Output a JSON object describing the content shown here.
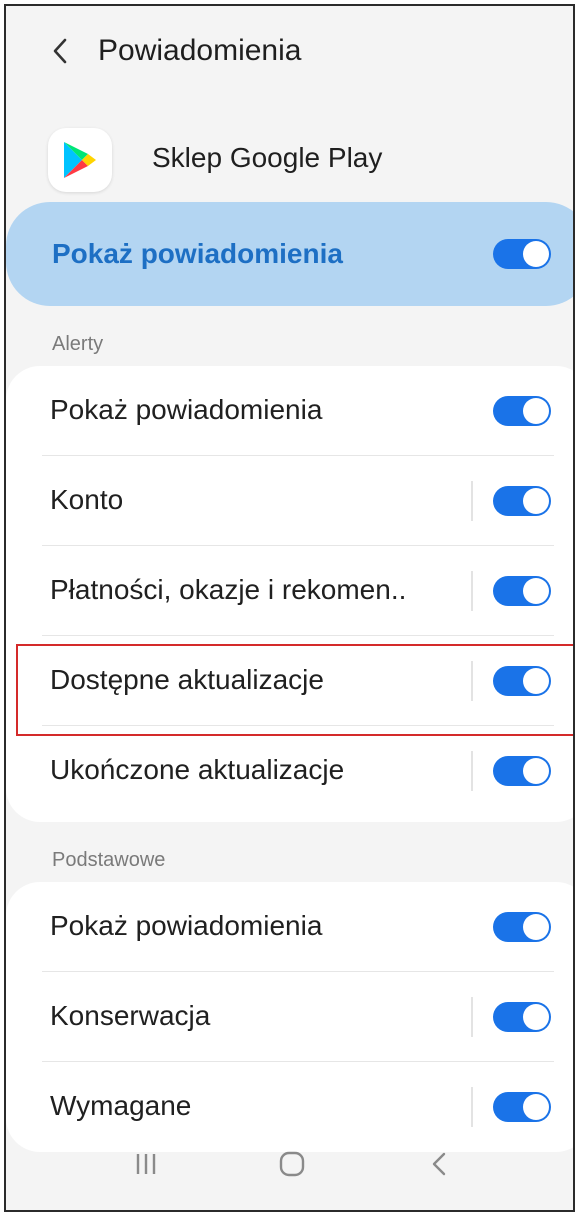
{
  "header": {
    "title": "Powiadomienia",
    "back_icon": "back-chevron-icon"
  },
  "app": {
    "name": "Sklep Google Play",
    "logo_icon": "google-play-logo"
  },
  "master_toggle": {
    "label": "Pokaż powiadomienia",
    "on": true
  },
  "sections": [
    {
      "title": "Alerty",
      "rows": [
        {
          "label": "Pokaż powiadomienia",
          "on": true,
          "separator": false
        },
        {
          "label": "Konto",
          "on": true,
          "separator": true
        },
        {
          "label": "Płatności, okazje i rekomen..",
          "on": true,
          "separator": true
        },
        {
          "label": "Dostępne aktualizacje",
          "on": true,
          "separator": true,
          "highlighted": true
        },
        {
          "label": "Ukończone aktualizacje",
          "on": true,
          "separator": true
        }
      ]
    },
    {
      "title": "Podstawowe",
      "rows": [
        {
          "label": "Pokaż powiadomienia",
          "on": true,
          "separator": false
        },
        {
          "label": "Konserwacja",
          "on": true,
          "separator": true
        },
        {
          "label": "Wymagane",
          "on": true,
          "separator": true
        }
      ]
    }
  ],
  "navbar": {
    "recent_icon": "recent-apps-icon",
    "home_icon": "home-icon",
    "back_icon": "back-icon"
  },
  "colors": {
    "accent": "#1a73e8",
    "master_bg": "#b3d5f2",
    "master_text": "#1d6fc4",
    "highlight_border": "#d42a2a"
  }
}
